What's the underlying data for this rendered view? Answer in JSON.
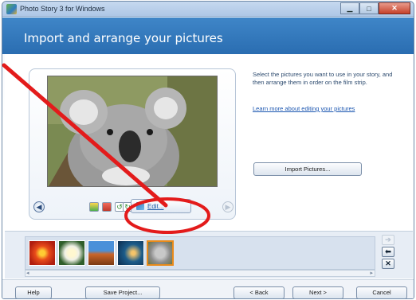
{
  "window": {
    "title": "Photo Story 3 for Windows"
  },
  "header": {
    "title": "Import and arrange your pictures"
  },
  "preview": {
    "edit_label": "Edit...",
    "prev_glyph": "◀",
    "next_glyph": "▶"
  },
  "sidebar": {
    "instructions": "Select the pictures you want to use in your story, and then arrange them in order on the film strip.",
    "learn_link": "Learn more about editing your pictures",
    "import_button": "Import Pictures..."
  },
  "filmstrip": {
    "thumbnails": [
      "flower-red",
      "flower-white",
      "canyon",
      "jellyfish",
      "koala"
    ],
    "selected": "koala"
  },
  "buttons": {
    "help": "Help",
    "save": "Save Project...",
    "back": "< Back",
    "next": "Next >",
    "cancel": "Cancel"
  },
  "colors": {
    "header_band": "#2a6db1",
    "annotation": "#e31b1b",
    "selected_thumb": "#e98a1a"
  }
}
